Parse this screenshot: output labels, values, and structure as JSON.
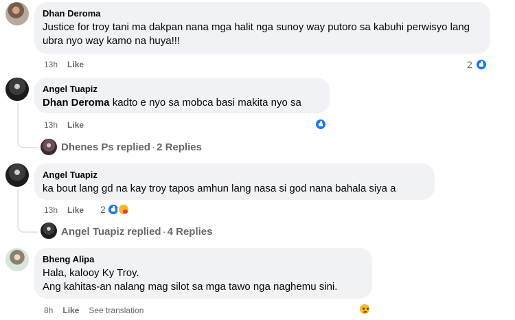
{
  "comments": [
    {
      "author": "Dhan Deroma",
      "text": "Justice for troy tani ma dakpan nana mga halit nga sunoy way putoro sa kabuhi perwisyo lang ubra nyo way kamo na huya!!!",
      "time": "13h",
      "like_label": "Like",
      "reaction_count": "2",
      "reactions": [
        "like-icon"
      ]
    },
    {
      "author": "Angel Tuapiz",
      "mention": "Dhan Deroma",
      "text": " kadto e nyo sa mobca basi makita nyo sa",
      "time": "13h",
      "like_label": "Like",
      "reactions": [
        "like-icon"
      ],
      "replies": {
        "author": "Dhenes Ps",
        "replied_label": "replied",
        "sep": "·",
        "count_label": "2 Replies"
      }
    },
    {
      "author": "Angel Tuapiz",
      "text": "ka bout lang gd na kay troy tapos amhun lang nasa si god nana bahala siya a",
      "time": "13h",
      "like_label": "Like",
      "reaction_count": "2",
      "reactions": [
        "like-icon",
        "care-icon"
      ],
      "replies": {
        "author": "Angel Tuapiz",
        "replied_label": "replied",
        "sep": "·",
        "count_label": "4 Replies"
      }
    },
    {
      "author": "Bheng Alipa",
      "line1": "Hala, kalooy Ky Troy.",
      "line2": "Ang kahitas-an nalang mag silot sa mga tawo nga naghemu sini.",
      "time": "8h",
      "like_label": "Like",
      "translate_label": "See translation",
      "reactions": [
        "sad-icon"
      ]
    }
  ],
  "colors": {
    "bubble": "#f0f2f5",
    "meta": "#65676b",
    "like_blue": "#1877f2"
  }
}
